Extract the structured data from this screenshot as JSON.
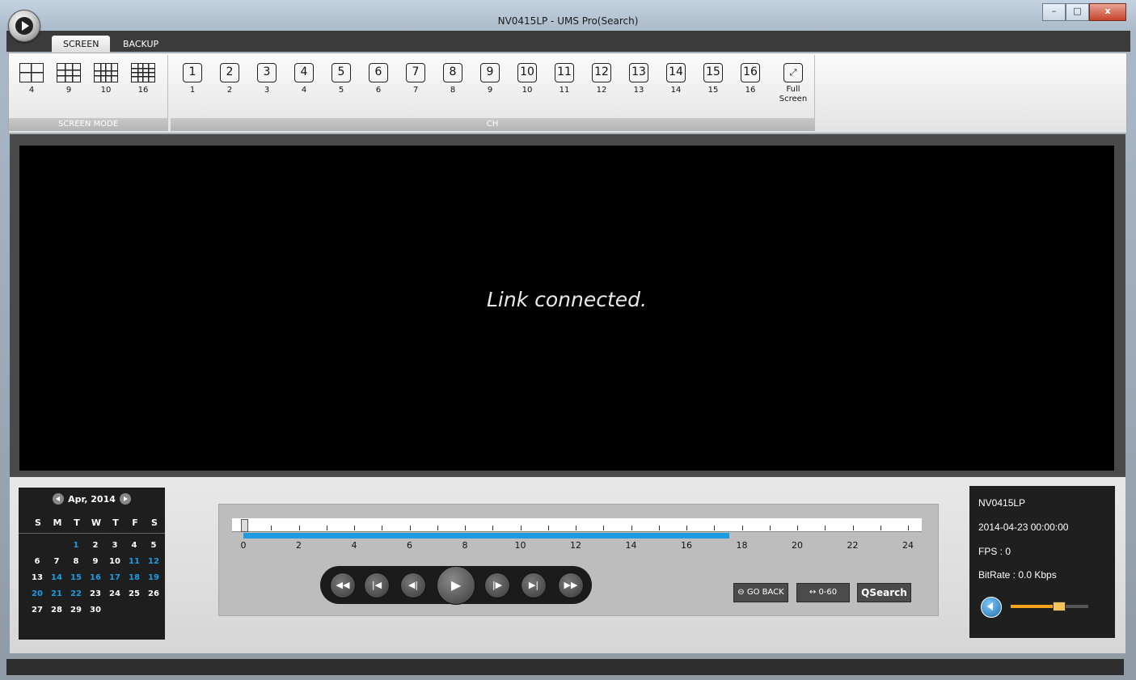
{
  "window": {
    "title": "NV0415LP - UMS Pro(Search)",
    "buttons": {
      "minimize": "–",
      "maximize": "□",
      "close": "x"
    }
  },
  "tabs": [
    {
      "label": "SCREEN",
      "active": true
    },
    {
      "label": "BACKUP",
      "active": false
    }
  ],
  "ribbon": {
    "screen_mode": {
      "label": "SCREEN MODE",
      "items": [
        {
          "label": "4",
          "grid": "2x2"
        },
        {
          "label": "9",
          "grid": "3x3"
        },
        {
          "label": "10",
          "grid": "custom-10"
        },
        {
          "label": "16",
          "grid": "4x4"
        }
      ]
    },
    "ch": {
      "label": "CH",
      "items": [
        {
          "icon": "1",
          "label": "1"
        },
        {
          "icon": "2",
          "label": "2"
        },
        {
          "icon": "3",
          "label": "3"
        },
        {
          "icon": "4",
          "label": "4"
        },
        {
          "icon": "5",
          "label": "5"
        },
        {
          "icon": "6",
          "label": "6"
        },
        {
          "icon": "7",
          "label": "7"
        },
        {
          "icon": "8",
          "label": "8"
        },
        {
          "icon": "9",
          "label": "9"
        },
        {
          "icon": "10",
          "label": "10"
        },
        {
          "icon": "11",
          "label": "11"
        },
        {
          "icon": "12",
          "label": "12"
        },
        {
          "icon": "13",
          "label": "13"
        },
        {
          "icon": "14",
          "label": "14"
        },
        {
          "icon": "15",
          "label": "15"
        },
        {
          "icon": "16",
          "label": "16"
        }
      ]
    },
    "fullscreen": {
      "label_line1": "Full",
      "label_line2": "Screen",
      "icon": "fullscreen-icon"
    }
  },
  "video": {
    "message": "Link connected."
  },
  "calendar": {
    "month_label": "Apr, 2014",
    "weekdays": [
      "S",
      "M",
      "T",
      "W",
      "T",
      "F",
      "S"
    ],
    "weeks": [
      [
        null,
        null,
        {
          "d": "1",
          "rec": true
        },
        {
          "d": "2",
          "rec": false
        },
        {
          "d": "3",
          "rec": false
        },
        {
          "d": "4",
          "rec": false
        },
        {
          "d": "5",
          "rec": false
        }
      ],
      [
        {
          "d": "6",
          "rec": false
        },
        {
          "d": "7",
          "rec": false
        },
        {
          "d": "8",
          "rec": false
        },
        {
          "d": "9",
          "rec": false
        },
        {
          "d": "10",
          "rec": false
        },
        {
          "d": "11",
          "rec": true
        },
        {
          "d": "12",
          "rec": true
        }
      ],
      [
        {
          "d": "13",
          "rec": false
        },
        {
          "d": "14",
          "rec": true
        },
        {
          "d": "15",
          "rec": true
        },
        {
          "d": "16",
          "rec": true
        },
        {
          "d": "17",
          "rec": true
        },
        {
          "d": "18",
          "rec": true
        },
        {
          "d": "19",
          "rec": true
        }
      ],
      [
        {
          "d": "20",
          "rec": true
        },
        {
          "d": "21",
          "rec": true
        },
        {
          "d": "22",
          "rec": true
        },
        {
          "d": "23",
          "rec": false
        },
        {
          "d": "24",
          "rec": false
        },
        {
          "d": "25",
          "rec": false
        },
        {
          "d": "26",
          "rec": false
        }
      ],
      [
        {
          "d": "27",
          "rec": false
        },
        {
          "d": "28",
          "rec": false
        },
        {
          "d": "29",
          "rec": false
        },
        {
          "d": "30",
          "rec": false
        },
        null,
        null,
        null
      ]
    ]
  },
  "timeline": {
    "labels": [
      "0",
      "2",
      "4",
      "6",
      "8",
      "10",
      "12",
      "14",
      "16",
      "18",
      "20",
      "22",
      "24"
    ],
    "recorded_hours": [
      0,
      19
    ],
    "playhead_hour": 0,
    "colors": {
      "recorded": "#1e9be3"
    }
  },
  "playback": {
    "buttons": [
      {
        "name": "fast-rewind",
        "glyph": "◀◀"
      },
      {
        "name": "skip-start",
        "glyph": "|◀"
      },
      {
        "name": "step-back",
        "glyph": "◀|"
      },
      {
        "name": "play",
        "glyph": "▶"
      },
      {
        "name": "step-forward",
        "glyph": "|▶"
      },
      {
        "name": "skip-end",
        "glyph": "▶|"
      },
      {
        "name": "fast-forward",
        "glyph": "▶▶"
      }
    ],
    "go_back": "GO BACK",
    "range": "0-60",
    "range_icon": "↔",
    "qsearch": "QSearch"
  },
  "info": {
    "device": "NV0415LP",
    "datetime": "2014-04-23 00:00:00",
    "fps": "FPS :  0",
    "bitrate": "BitRate :  0.0 Kbps",
    "volume": 0.6
  }
}
